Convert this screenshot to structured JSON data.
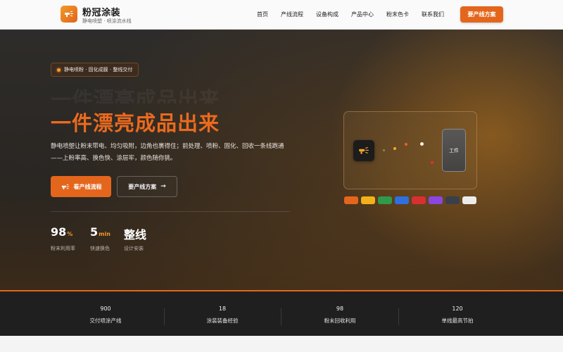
{
  "header": {
    "logo_icon": "spray-gun-icon",
    "brand_title": "粉冠涂装",
    "brand_subtitle": "静电喷塑 · 喷涂流水线",
    "nav": [
      "首页",
      "产线流程",
      "设备构成",
      "产品中心",
      "粉末色卡",
      "联系我们"
    ],
    "cta_label": "要产线方案"
  },
  "hero": {
    "badge": "静电喷粉 · 固化成膜 · 整线交付",
    "title": "一件漂亮成品出来",
    "description": "静电喷塑让粉末带电、均匀吸附，边角也裹得住；前处理、喷粉、固化、回收一条线跑通——上粉率高、换色快、涂层牢，颜色随你挑。",
    "primary_button": "看产线流程",
    "secondary_button": "要产线方案",
    "secondary_arrow": "→",
    "stats": [
      {
        "value": "98",
        "unit": "%",
        "label": "粉末利用率"
      },
      {
        "value": "5",
        "unit": "min",
        "label": "快速换色"
      },
      {
        "value": "整线",
        "unit": "",
        "label": "设计安装"
      }
    ],
    "illustration": {
      "workpiece_label": "工件",
      "swatches": [
        "#e4661c",
        "#f2b01a",
        "#2e9a4a",
        "#2f6fe0",
        "#d83030",
        "#8a46e0",
        "#3a3f4a",
        "#ececec"
      ]
    }
  },
  "strip": [
    {
      "num": "900",
      "label": "交付喷涂产线"
    },
    {
      "num": "18",
      "label": "涂装装备经验"
    },
    {
      "num": "98",
      "label": "粉末回收利用"
    },
    {
      "num": "120",
      "label": "单线最高节拍"
    }
  ],
  "colors": {
    "accent": "#e4661c",
    "accent_light": "#f39a2a",
    "hero_bg": "#2b2825",
    "strip_bg": "#1f1f1f"
  }
}
